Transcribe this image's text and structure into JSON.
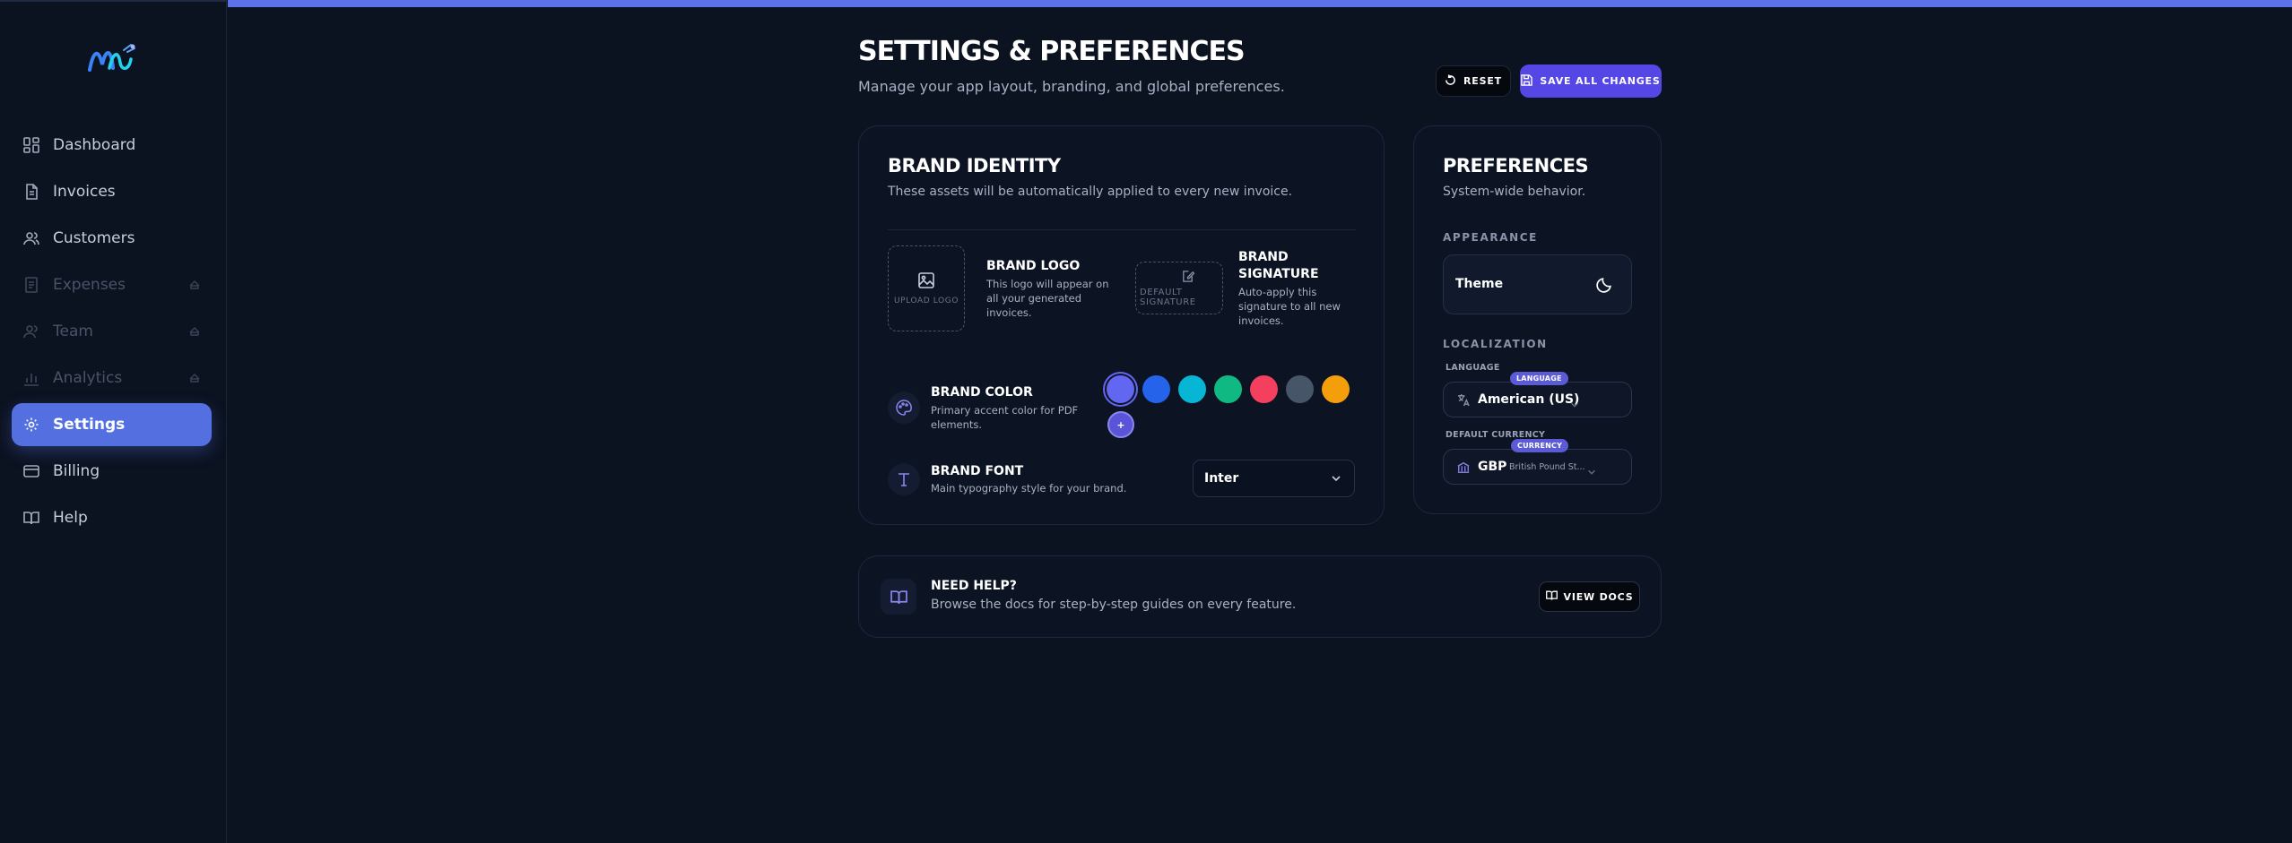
{
  "sidebar": {
    "items": [
      {
        "label": "Dashboard",
        "icon": "dashboard-grid-icon",
        "state": "normal"
      },
      {
        "label": "Invoices",
        "icon": "document-icon",
        "state": "normal"
      },
      {
        "label": "Customers",
        "icon": "users-icon",
        "state": "normal"
      },
      {
        "label": "Expenses",
        "icon": "receipt-icon",
        "state": "locked"
      },
      {
        "label": "Team",
        "icon": "team-icon",
        "state": "locked"
      },
      {
        "label": "Analytics",
        "icon": "chart-icon",
        "state": "locked"
      },
      {
        "label": "Settings",
        "icon": "gear-icon",
        "state": "active"
      },
      {
        "label": "Billing",
        "icon": "credit-card-icon",
        "state": "normal"
      },
      {
        "label": "Help",
        "icon": "book-icon",
        "state": "normal"
      }
    ]
  },
  "header": {
    "title": "SETTINGS & PREFERENCES",
    "subtitle": "Manage your app layout, branding, and global preferences.",
    "reset_label": "RESET",
    "save_label": "SAVE ALL CHANGES"
  },
  "brand": {
    "title": "BRAND IDENTITY",
    "subtitle": "These assets will be automatically applied to every new invoice.",
    "logo": {
      "upload_label": "UPLOAD LOGO",
      "title": "BRAND LOGO",
      "desc_lines": [
        "This logo will appear on",
        "all your generated",
        "invoices."
      ]
    },
    "signature": {
      "placeholder_lines": [
        "DEFAULT",
        "SIGNATURE"
      ],
      "title_lines": [
        "BRAND",
        "SIGNATURE"
      ],
      "desc_lines": [
        "Auto-apply this",
        "signature to all new",
        "invoices."
      ]
    },
    "color": {
      "title": "BRAND COLOR",
      "desc_lines": [
        "Primary accent color for PDF",
        "elements."
      ],
      "swatches": [
        "#6366f1",
        "#2563eb",
        "#06b6d4",
        "#10b981",
        "#f43f5e",
        "#475569",
        "#f59e0b"
      ],
      "selected_index": 0,
      "add_label": "+"
    },
    "font": {
      "title": "BRAND FONT",
      "desc": "Main typography style for your brand.",
      "selected": "Inter"
    }
  },
  "preferences": {
    "title": "PREFERENCES",
    "subtitle": "System-wide behavior.",
    "appearance_label": "APPEARANCE",
    "theme_label": "Theme",
    "localization_label": "LOCALIZATION",
    "language": {
      "label": "LANGUAGE",
      "badge": "LANGUAGE",
      "value": "American (US)"
    },
    "currency": {
      "label": "DEFAULT CURRENCY",
      "badge": "CURRENCY",
      "code": "GBP",
      "name": "British Pound St..."
    }
  },
  "help": {
    "title": "NEED HELP?",
    "desc": "Browse the docs for step-by-step guides on every feature.",
    "button_label": "VIEW DOCS"
  },
  "colors": {
    "accent": "#5b72e8",
    "save_button": "#5546e6",
    "active_nav": "#5470e0",
    "background": "#0b1220"
  }
}
